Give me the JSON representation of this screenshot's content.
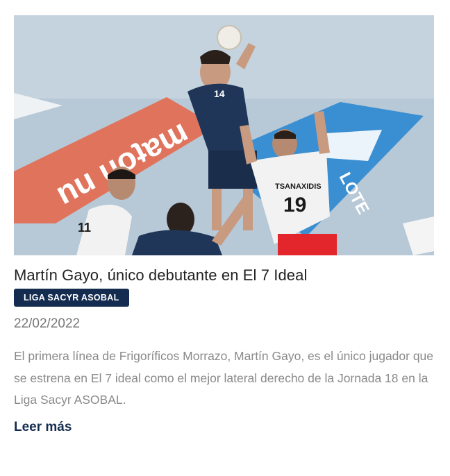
{
  "article": {
    "image_alt": "Martín Gayo en acción",
    "title": "Martín Gayo, único debutante en El 7 Ideal",
    "category": "LIGA SACYR ASOBAL",
    "date": "22/02/2022",
    "excerpt": "El primera línea de Frigoríficos Morrazo, Martín Gayo, es el único jugador que se estrena en El 7 ideal como el mejor lateral derecho de la Jornada 18 en la Liga Sacyr ASOBAL.",
    "read_more": "Leer más"
  },
  "photo_text": {
    "court_ad": "nu ɥoʇɐɯ",
    "blue_ad": "LOTE",
    "player_name": "TSANAXIDIS",
    "player_number": "19",
    "jersey_14": "14",
    "jersey_11": "11"
  },
  "colors": {
    "badge_bg": "#142c4f",
    "link": "#142c4f",
    "title": "#222222",
    "text_muted": "#8a8a8a"
  }
}
